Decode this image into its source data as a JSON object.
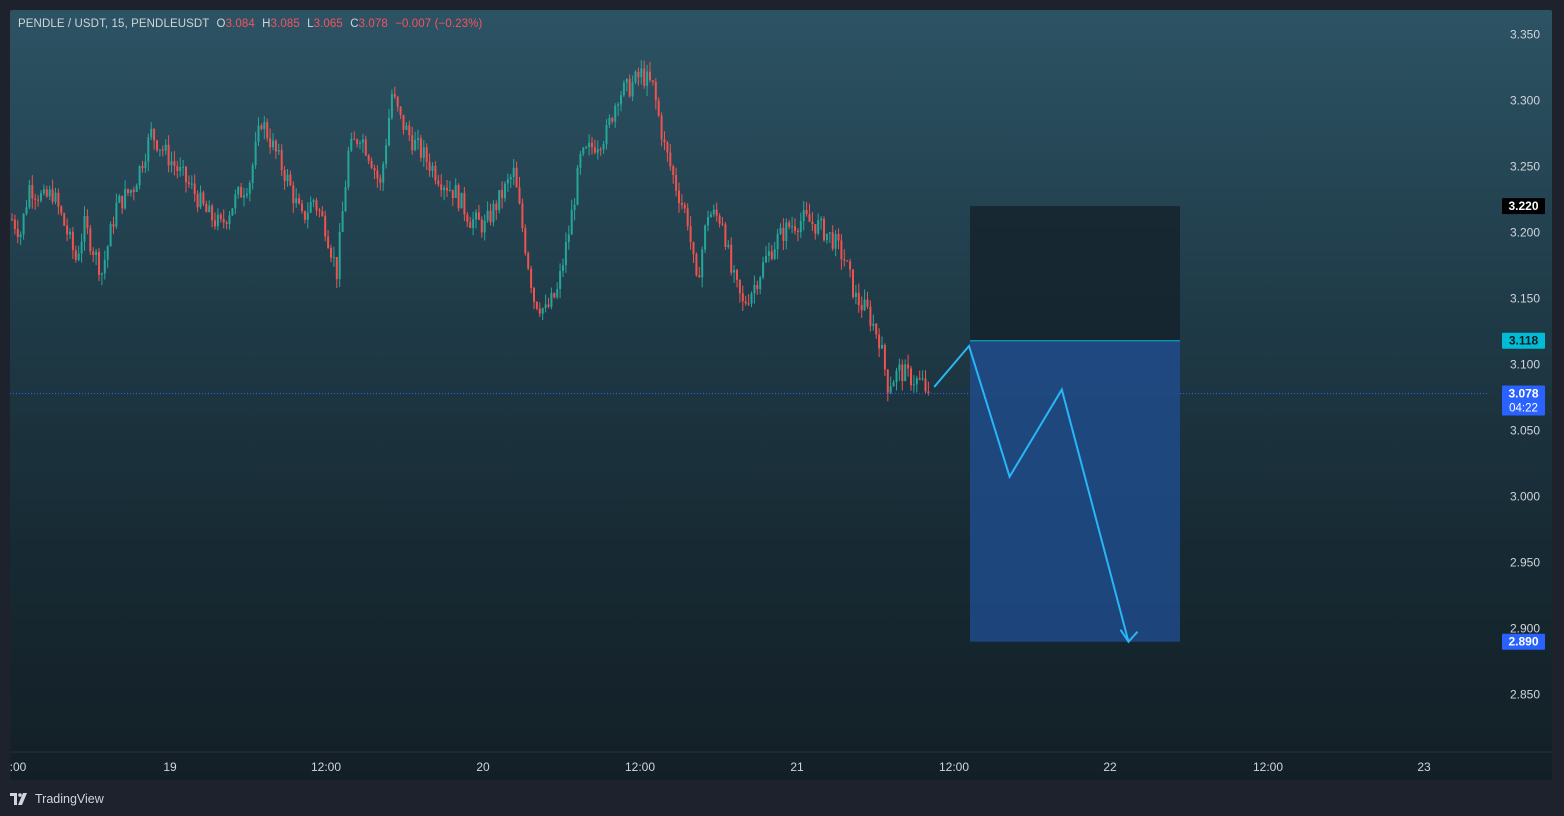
{
  "header": {
    "symbol": "PENDLE / USDT, 15, PENDLEUSDT",
    "o_label": "O",
    "o_value": "3.084",
    "h_label": "H",
    "h_value": "3.085",
    "l_label": "L",
    "l_value": "3.065",
    "c_label": "C",
    "c_value": "3.078",
    "change": "−0.007 (−0.23%)"
  },
  "footer": {
    "brand": "TradingView",
    "logo_icon": "tradingview-logo-icon"
  },
  "colors": {
    "up": "#26a69a",
    "down": "#ef5350",
    "projection": "#29b6f6",
    "target_zone": "#1e4b8a",
    "stop_zone": "#15232d",
    "entry_badge": "#00bcd4",
    "target_badge": "#2962ff",
    "last_price_badge": "#2962ff"
  },
  "chart_data": {
    "type": "candlestick",
    "ylim": [
      2.82,
      3.36
    ],
    "yticks": [
      "3.350",
      "3.300",
      "3.250",
      "3.200",
      "3.150",
      "3.100",
      "3.050",
      "3.000",
      "2.950",
      "2.900",
      "2.850"
    ],
    "xticks": [
      ":00",
      "19",
      "12:00",
      "20",
      "12:00",
      "21",
      "12:00",
      "22",
      "12:00",
      "23"
    ],
    "price_path": [
      {
        "t": 0,
        "p": 3.21
      },
      {
        "t": 3,
        "p": 3.2
      },
      {
        "t": 6,
        "p": 3.235
      },
      {
        "t": 11,
        "p": 3.225
      },
      {
        "t": 14,
        "p": 3.23
      },
      {
        "t": 19,
        "p": 3.2
      },
      {
        "t": 22,
        "p": 3.18
      },
      {
        "t": 25,
        "p": 3.205
      },
      {
        "t": 31,
        "p": 3.17
      },
      {
        "t": 36,
        "p": 3.22
      },
      {
        "t": 42,
        "p": 3.235
      },
      {
        "t": 48,
        "p": 3.275
      },
      {
        "t": 53,
        "p": 3.26
      },
      {
        "t": 58,
        "p": 3.245
      },
      {
        "t": 63,
        "p": 3.23
      },
      {
        "t": 67,
        "p": 3.215
      },
      {
        "t": 72,
        "p": 3.205
      },
      {
        "t": 77,
        "p": 3.225
      },
      {
        "t": 82,
        "p": 3.24
      },
      {
        "t": 86,
        "p": 3.285
      },
      {
        "t": 90,
        "p": 3.265
      },
      {
        "t": 95,
        "p": 3.24
      },
      {
        "t": 100,
        "p": 3.21
      },
      {
        "t": 104,
        "p": 3.225
      },
      {
        "t": 108,
        "p": 3.205
      },
      {
        "t": 112,
        "p": 3.17
      },
      {
        "t": 116,
        "p": 3.26
      },
      {
        "t": 120,
        "p": 3.275
      },
      {
        "t": 124,
        "p": 3.255
      },
      {
        "t": 127,
        "p": 3.235
      },
      {
        "t": 131,
        "p": 3.305
      },
      {
        "t": 134,
        "p": 3.285
      },
      {
        "t": 138,
        "p": 3.27
      },
      {
        "t": 143,
        "p": 3.255
      },
      {
        "t": 148,
        "p": 3.24
      },
      {
        "t": 153,
        "p": 3.23
      },
      {
        "t": 158,
        "p": 3.21
      },
      {
        "t": 163,
        "p": 3.205
      },
      {
        "t": 168,
        "p": 3.225
      },
      {
        "t": 173,
        "p": 3.245
      },
      {
        "t": 177,
        "p": 3.19
      },
      {
        "t": 180,
        "p": 3.15
      },
      {
        "t": 184,
        "p": 3.14
      },
      {
        "t": 188,
        "p": 3.155
      },
      {
        "t": 192,
        "p": 3.2
      },
      {
        "t": 196,
        "p": 3.255
      },
      {
        "t": 200,
        "p": 3.265
      },
      {
        "t": 205,
        "p": 3.275
      },
      {
        "t": 209,
        "p": 3.305
      },
      {
        "t": 213,
        "p": 3.31
      },
      {
        "t": 217,
        "p": 3.32
      },
      {
        "t": 221,
        "p": 3.31
      },
      {
        "t": 225,
        "p": 3.265
      },
      {
        "t": 229,
        "p": 3.235
      },
      {
        "t": 233,
        "p": 3.21
      },
      {
        "t": 236,
        "p": 3.16
      },
      {
        "t": 240,
        "p": 3.215
      },
      {
        "t": 245,
        "p": 3.21
      },
      {
        "t": 248,
        "p": 3.17
      },
      {
        "t": 252,
        "p": 3.145
      },
      {
        "t": 256,
        "p": 3.16
      },
      {
        "t": 260,
        "p": 3.18
      },
      {
        "t": 264,
        "p": 3.195
      },
      {
        "t": 268,
        "p": 3.205
      },
      {
        "t": 273,
        "p": 3.21
      },
      {
        "t": 278,
        "p": 3.205
      },
      {
        "t": 283,
        "p": 3.195
      },
      {
        "t": 287,
        "p": 3.18
      },
      {
        "t": 291,
        "p": 3.15
      },
      {
        "t": 295,
        "p": 3.14
      },
      {
        "t": 299,
        "p": 3.12
      },
      {
        "t": 302,
        "p": 3.085
      },
      {
        "t": 306,
        "p": 3.095
      },
      {
        "t": 310,
        "p": 3.09
      },
      {
        "t": 314,
        "p": 3.085
      },
      {
        "t": 316,
        "p": 3.078
      }
    ],
    "projection_path": [
      {
        "t": 318,
        "p": 3.083
      },
      {
        "t": 330,
        "p": 3.114
      },
      {
        "t": 344,
        "p": 3.015
      },
      {
        "t": 362,
        "p": 3.081
      },
      {
        "t": 385,
        "p": 2.89
      }
    ],
    "position": {
      "type": "short",
      "stop_price": 3.22,
      "entry_price": 3.118,
      "target_price": 2.89,
      "stop_label": "3.220",
      "entry_label": "3.118",
      "target_label": "2.890"
    },
    "last_price": {
      "value": 3.078,
      "label": "3.078",
      "countdown": "04:22"
    }
  }
}
